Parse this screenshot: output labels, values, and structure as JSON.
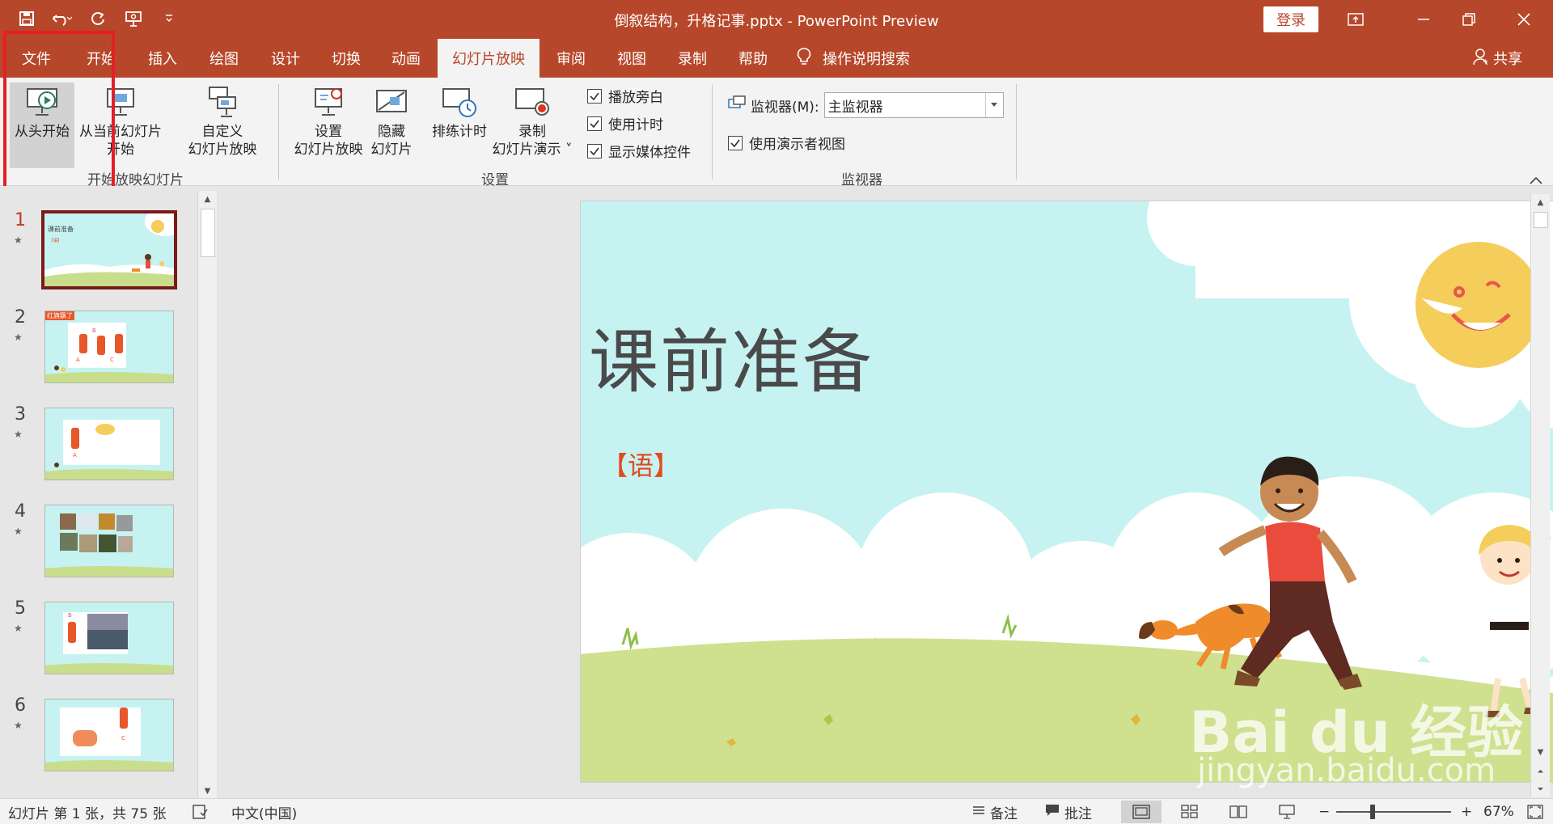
{
  "titlebar": {
    "doc_title": "倒叙结构，升格记事.pptx  -  PowerPoint Preview",
    "login": "登录",
    "qat_icons": [
      "save-icon",
      "undo-icon",
      "redo-icon",
      "present-icon",
      "customize-icon"
    ]
  },
  "tabs": [
    "文件",
    "开始",
    "插入",
    "绘图",
    "设计",
    "切换",
    "动画",
    "幻灯片放映",
    "审阅",
    "视图",
    "录制",
    "帮助"
  ],
  "active_tab": "幻灯片放映",
  "tell_me": "操作说明搜索",
  "share": "共享",
  "ribbon": {
    "from_beginning": "从头开始",
    "from_current_line1": "从当前幻灯片",
    "from_current_line2": "开始",
    "custom_line1": "自定义",
    "custom_line2": "幻灯片放映",
    "group_start": "开始放映幻灯片",
    "setup_line1": "设置",
    "setup_line2": "幻灯片放映",
    "hide_line1": "隐藏",
    "hide_line2": "幻灯片",
    "rehearse": "排练计时",
    "record_line1": "录制",
    "record_line2": "幻灯片演示",
    "check_narration": "播放旁白",
    "check_timings": "使用计时",
    "check_media": "显示媒体控件",
    "group_setup": "设置",
    "monitor_label": "监视器(M):",
    "monitor_value": "主监视器",
    "presenter_view": "使用演示者视图",
    "group_monitor": "监视器"
  },
  "thumbnails": [
    {
      "num": "1",
      "title": "课前准备",
      "sub": "【语】"
    },
    {
      "num": "2",
      "banner": "红旗飘了",
      "letters": [
        "A",
        "B",
        "C"
      ]
    },
    {
      "num": "3",
      "letters": [
        "A"
      ]
    },
    {
      "num": "4"
    },
    {
      "num": "5",
      "letters": [
        "B"
      ]
    },
    {
      "num": "6",
      "letters": [
        "C"
      ]
    }
  ],
  "slide": {
    "title": "课前准备",
    "subtitle": "【语】"
  },
  "statusbar": {
    "slide_info": "幻灯片 第 1 张，共 75 张",
    "language": "中文(中国)",
    "notes": "备注",
    "comments": "批注",
    "zoom_minus": "−",
    "zoom_plus": "+",
    "zoom_level": "67%"
  },
  "watermark": {
    "brand": "Bai du 经验",
    "url": "jingyan.baidu.com"
  },
  "colors": {
    "accent": "#b7472a",
    "annotation": "#e51f24",
    "slide_bg": "#c6f3f1"
  }
}
